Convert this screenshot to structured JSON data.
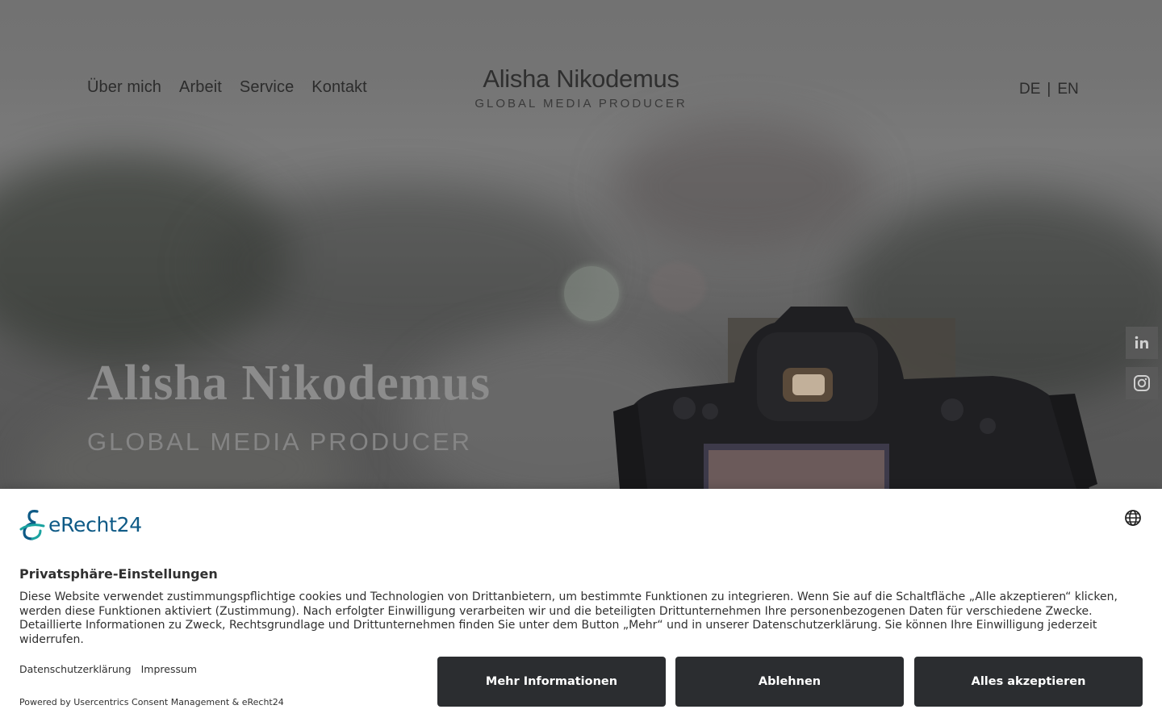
{
  "header": {
    "nav": [
      "Über mich",
      "Arbeit",
      "Service",
      "Kontakt"
    ],
    "logo_name": "Alisha Nikodemus",
    "logo_sub": "GLOBAL MEDIA PRODUCER",
    "lang_de": "DE",
    "lang_sep": "|",
    "lang_en": "EN"
  },
  "hero": {
    "title": "Alisha Nikodemus",
    "subtitle": "GLOBAL MEDIA PRODUCER"
  },
  "social": {
    "icons": [
      "linkedin-icon",
      "instagram-icon"
    ]
  },
  "consent": {
    "brand": "eRecht24",
    "title": "Privatsphäre-Einstellungen",
    "text": "Diese Website verwendet zustimmungspflichtige cookies und Technologien von Drittanbietern, um bestimmte Funktionen zu integrieren. Wenn Sie auf die Schaltfläche „Alle akzeptieren“ klicken, werden diese Funktionen aktiviert (Zustimmung). Nach erfolgter Einwilligung verarbeiten wir und die beteiligten Drittunternehmen Ihre personenbezogenen Daten für verschiedene Zwecke. Detaillierte Informationen zu Zweck, Rechtsgrundlage und Drittunternehmen finden Sie unter dem Button „Mehr“ und in unserer Datenschutzerklärung. Sie können Ihre Einwilligung jederzeit widerrufen.",
    "link_privacy": "Datenschutzerklärung",
    "link_imprint": "Impressum",
    "powered": "Powered by Usercentrics Consent Management & eRecht24",
    "btn_more": "Mehr Informationen",
    "btn_decline": "Ablehnen",
    "btn_accept": "Alles akzeptieren"
  },
  "colors": {
    "button_bg": "#2b2d30",
    "brand": "#0e5a86"
  }
}
